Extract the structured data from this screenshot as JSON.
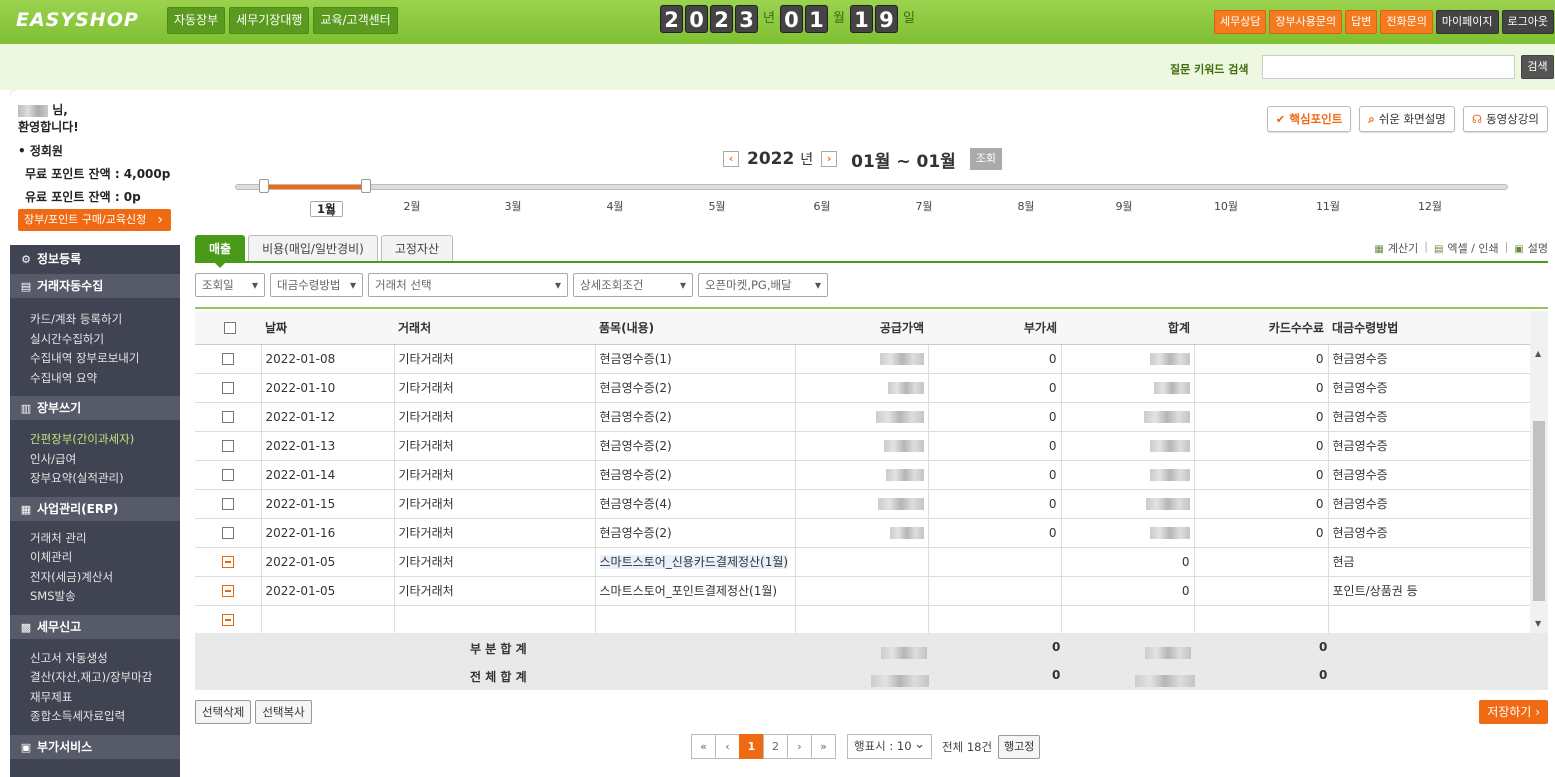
{
  "header": {
    "logo": "EASYSHOP",
    "nav": [
      "자동장부",
      "세무기장대행",
      "교육/고객센터"
    ],
    "date": {
      "y": [
        "2",
        "0",
        "2",
        "3"
      ],
      "y_unit": "년",
      "m": [
        "0",
        "1"
      ],
      "m_unit": "월",
      "d": [
        "1",
        "9"
      ],
      "d_unit": "일"
    },
    "links_orange": [
      "세무상담",
      "장부사용문의",
      "답변",
      "전화문의"
    ],
    "links_dark": [
      "마이페이지",
      "로그아웃"
    ]
  },
  "search": {
    "label": "질문 키워드 검색",
    "button": "검색",
    "value": ""
  },
  "sidebar": {
    "greet_suffix": "님,",
    "greet_line2": "환영합니다!",
    "grade": "• 정회원",
    "free_points": "무료 포인트 잔액 : 4,000p",
    "paid_points": "유료 포인트 잔액 : 0p",
    "buy_button": "장부/포인트 구매/교육신청",
    "sections": [
      {
        "title": "정보등록",
        "icon": "gear-icon",
        "items": []
      },
      {
        "title": "거래자동수집",
        "icon": "collect-icon",
        "items": [
          "카드/계좌 등록하기",
          "실시간수집하기",
          "수집내역 장부로보내기",
          "수집내역 요약"
        ]
      },
      {
        "title": "장부쓰기",
        "icon": "book-icon",
        "items": [
          "간편장부(간이과세자)",
          "인사/급여",
          "장부요약(실적관리)"
        ]
      },
      {
        "title": "사업관리(ERP)",
        "icon": "keyboard-icon",
        "items": [
          "거래처 관리",
          "이체관리",
          "전자(세금)계산서",
          "SMS발송"
        ]
      },
      {
        "title": "세무신고",
        "icon": "chart-icon",
        "items": [
          "신고서 자동생성",
          "결산(자산,재고)/장부마감",
          "재무제표",
          "종합소득세자료입력"
        ]
      },
      {
        "title": "부가서비스",
        "icon": "box-icon",
        "items": []
      }
    ],
    "active_item": "간편장부(간이과세자)"
  },
  "toolbar": {
    "core": "핵심포인트",
    "easy": "쉬운 화면설명",
    "video": "동영상강의"
  },
  "period": {
    "year": "2022",
    "year_unit": "년",
    "range": "01월 ~ 01월",
    "lookup": "조회",
    "months": [
      "1월",
      "2월",
      "3월",
      "4월",
      "5월",
      "6월",
      "7월",
      "8월",
      "9월",
      "10월",
      "11월",
      "12월"
    ],
    "selected_month": "1월"
  },
  "tabs": [
    "매출",
    "비용(매입/일반경비)",
    "고정자산"
  ],
  "tools": [
    "계산기",
    "엑셀 / 인쇄",
    "설명"
  ],
  "filters": [
    "조회일",
    "대금수령방법",
    "거래처 선택",
    "상세조회조건",
    "오픈마켓,PG,배달"
  ],
  "table": {
    "headers": [
      "날짜",
      "거래처",
      "품목(내용)",
      "공급가액",
      "부가세",
      "합계",
      "카드수수료",
      "대금수령방법"
    ],
    "rows": [
      {
        "date": "2022-01-08",
        "vendor": "기타거래처",
        "item": "현금영수증(1)",
        "vat": "0",
        "fee": "0",
        "method": "현금영수증"
      },
      {
        "date": "2022-01-10",
        "vendor": "기타거래처",
        "item": "현금영수증(2)",
        "vat": "0",
        "fee": "0",
        "method": "현금영수증"
      },
      {
        "date": "2022-01-12",
        "vendor": "기타거래처",
        "item": "현금영수증(2)",
        "vat": "0",
        "fee": "0",
        "method": "현금영수증"
      },
      {
        "date": "2022-01-13",
        "vendor": "기타거래처",
        "item": "현금영수증(2)",
        "vat": "0",
        "fee": "0",
        "method": "현금영수증"
      },
      {
        "date": "2022-01-14",
        "vendor": "기타거래처",
        "item": "현금영수증(2)",
        "vat": "0",
        "fee": "0",
        "method": "현금영수증"
      },
      {
        "date": "2022-01-15",
        "vendor": "기타거래처",
        "item": "현금영수증(4)",
        "vat": "0",
        "fee": "0",
        "method": "현금영수증"
      },
      {
        "date": "2022-01-16",
        "vendor": "기타거래처",
        "item": "현금영수증(2)",
        "vat": "0",
        "fee": "0",
        "method": "현금영수증"
      },
      {
        "date": "2022-01-05",
        "vendor": "기타거래처",
        "item": "스마트스토어_신용카드결제정산(1월)",
        "total": "0",
        "method": "현금"
      },
      {
        "date": "2022-01-05",
        "vendor": "기타거래처",
        "item": "스마트스토어_포인트결제정산(1월)",
        "total": "0",
        "method": "포인트/상품권 등"
      }
    ],
    "subtotal_label": "부 분 합 계",
    "subtotal_vat": "0",
    "subtotal_fee": "0",
    "total_label": "전 체 합 계",
    "total_vat": "0",
    "total_fee": "0"
  },
  "actions": {
    "delete": "선택삭제",
    "copy": "선택복사",
    "save": "저장하기"
  },
  "pagination": {
    "first": "«",
    "prev": "‹",
    "pages": [
      "1",
      "2"
    ],
    "next": "›",
    "last": "»",
    "rows_per_page": "행표시 : 10",
    "total": "전체 18건",
    "fix": "행고정"
  }
}
